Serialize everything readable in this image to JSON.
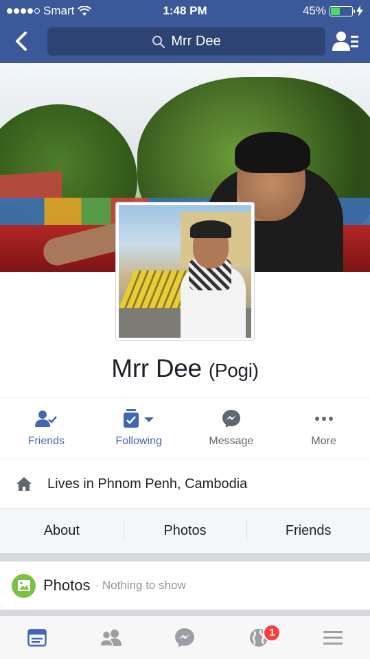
{
  "status_bar": {
    "carrier": "Smart",
    "time": "1:48 PM",
    "battery": "45%",
    "battery_level": 0.45,
    "signal_bars": 4
  },
  "nav": {
    "search_text": "Mrr Dee",
    "back_icon": "chevron-left-icon",
    "contacts_icon": "friend-list-icon"
  },
  "profile": {
    "name": "Mrr Dee",
    "alternate_name": "(Pogi)"
  },
  "actions": [
    {
      "label": "Friends",
      "icon": "friends-check-icon",
      "active": true
    },
    {
      "label": "Following",
      "icon": "following-icon",
      "active": true
    },
    {
      "label": "Message",
      "icon": "messenger-icon",
      "active": false
    },
    {
      "label": "More",
      "icon": "more-dots-icon",
      "active": false
    }
  ],
  "intro": {
    "lives_in": "Lives in Phnom Penh, Cambodia"
  },
  "tabs": [
    {
      "label": "About"
    },
    {
      "label": "Photos"
    },
    {
      "label": "Friends"
    }
  ],
  "photos_section": {
    "title": "Photos",
    "note": "· Nothing to show"
  },
  "bottom_bar": {
    "notifications_badge": "1"
  },
  "colors": {
    "brand_blue": "#3b5998",
    "search_bg": "#2d4373",
    "action_blue": "#4267b2",
    "badge_red": "#fa3e3e",
    "photos_green": "#7bc146"
  }
}
